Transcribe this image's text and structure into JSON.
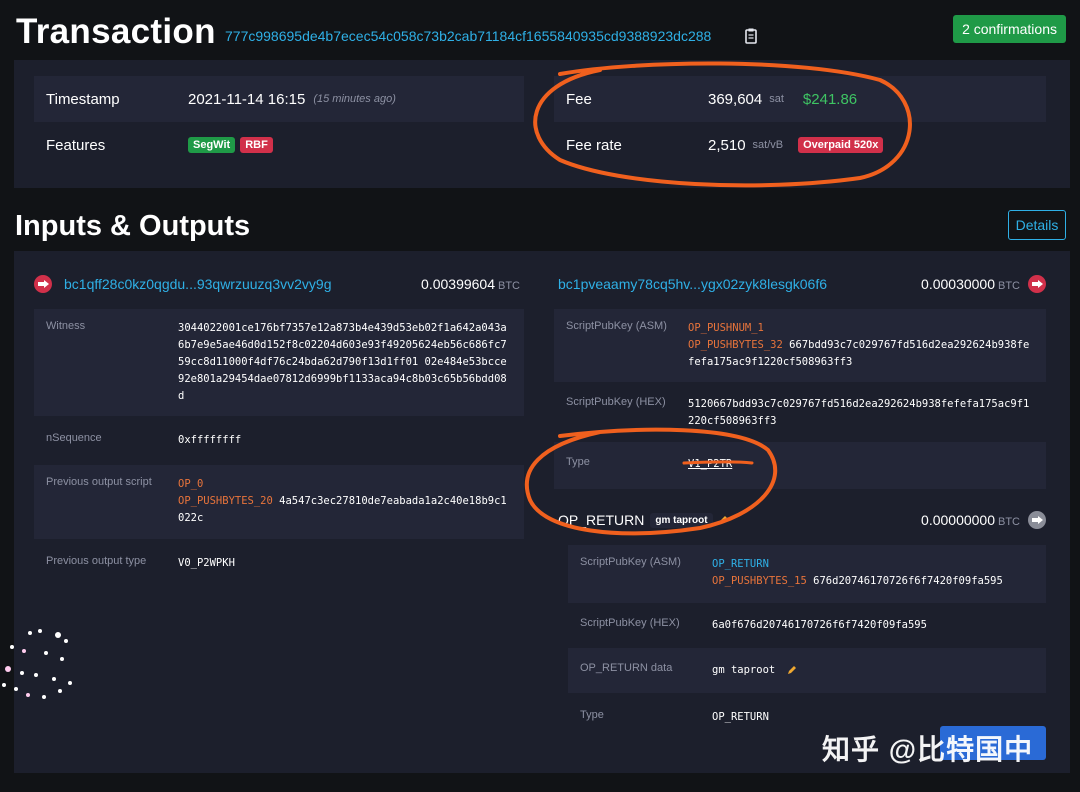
{
  "header": {
    "title": "Transaction",
    "txid": "777c998695de4b7ecec54c058c73b2cab71184cf1655840935cd9388923dc288",
    "confirmations": "2 confirmations"
  },
  "summary": {
    "timestamp_label": "Timestamp",
    "timestamp_value": "2021-11-14 16:15",
    "timestamp_relative": "(15 minutes ago)",
    "features_label": "Features",
    "features": [
      "SegWit",
      "RBF"
    ],
    "fee_label": "Fee",
    "fee_value": "369,604",
    "fee_unit": "sat",
    "fee_usd": "$241.86",
    "fee_rate_label": "Fee rate",
    "fee_rate_value": "2,510",
    "fee_rate_unit": "sat/vB",
    "overpaid_badge": "Overpaid 520x"
  },
  "io": {
    "title": "Inputs & Outputs",
    "details_button": "Details",
    "input": {
      "address": "bc1qff28c0kz0qgdu...93qwrzuuzq3vv2vy9g",
      "amount": "0.00399604",
      "unit": "BTC",
      "witness_label": "Witness",
      "witness_value": "3044022001ce176bf7357e12a873b4e439d53eb02f1a642a043a6b7e9e5ae46d0d152f8c02204d603e93f49205624eb56c686fc759cc8d11000f4df76c24bda62d790f13d1ff01 02e484e53bcce92e801a29454dae07812d6999bf1133aca94c8b03c65b56bdd08d",
      "nsequence_label": "nSequence",
      "nsequence_value": "0xffffffff",
      "prev_script_label": "Previous output script",
      "prev_script_op1": "OP_0",
      "prev_script_op2": "OP_PUSHBYTES_20",
      "prev_script_data": "4a547c3ec27810de7eabada1a2c40e18b9c1022c",
      "prev_type_label": "Previous output type",
      "prev_type_value": "V0_P2WPKH"
    },
    "output1": {
      "address": "bc1pveaamy78cq5hv...ygx02zyk8lesgk06f6",
      "amount": "0.00030000",
      "unit": "BTC",
      "asm_label": "ScriptPubKey (ASM)",
      "asm_op1": "OP_PUSHNUM_1",
      "asm_op2": "OP_PUSHBYTES_32",
      "asm_data": "667bdd93c7c029767fd516d2ea292624b938fefefa175ac9f1220cf508963ff3",
      "hex_label": "ScriptPubKey (HEX)",
      "hex_value": "5120667bdd93c7c029767fd516d2ea292624b938fefefa175ac9f1220cf508963ff3",
      "type_label": "Type",
      "type_value": "V1_P2TR"
    },
    "output2": {
      "title": "OP_RETURN",
      "tag": "gm taproot",
      "amount": "0.00000000",
      "unit": "BTC",
      "asm_label": "ScriptPubKey (ASM)",
      "asm_op1": "OP_RETURN",
      "asm_op2": "OP_PUSHBYTES_15",
      "asm_data": "676d20746170726f6f7420f09fa595",
      "hex_label": "ScriptPubKey (HEX)",
      "hex_value": "6a0f676d20746170726f6f7420f09fa595",
      "data_label": "OP_RETURN data",
      "data_value": "gm taproot",
      "type_label": "Type",
      "type_value": "OP_RETURN"
    }
  },
  "watermark": "知乎 @比特国中",
  "colors": {
    "background": "#111316",
    "panel": "#1c1f2c",
    "link": "#2fb0e6",
    "success": "#1f9a47",
    "danger": "#d1304a",
    "opcode": "#e8743b",
    "annotation": "#f0601e"
  }
}
